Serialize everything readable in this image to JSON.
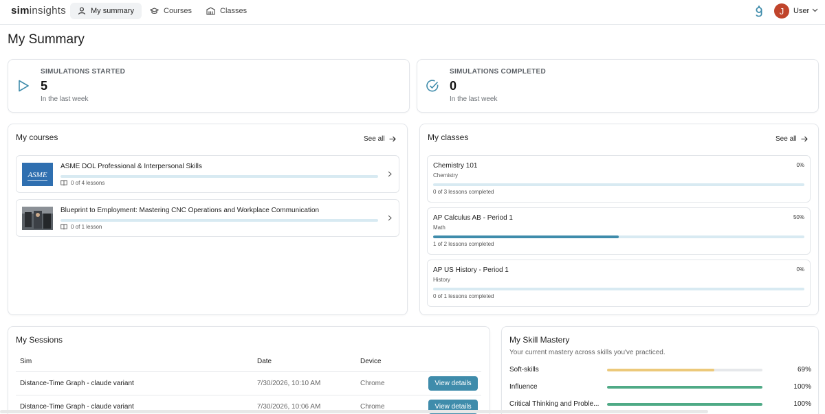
{
  "app": {
    "logo_bold": "sim",
    "logo_light": "insights",
    "nav": [
      {
        "label": "My summary",
        "icon": "user-icon",
        "active": true
      },
      {
        "label": "Courses",
        "icon": "graduation-cap-icon",
        "active": false
      },
      {
        "label": "Classes",
        "icon": "building-icon",
        "active": false
      }
    ],
    "user": {
      "initial": "J",
      "name": "User"
    }
  },
  "page_title": "My Summary",
  "stats": {
    "started": {
      "label": "SIMULATIONS STARTED",
      "value": "5",
      "sub": "In the last week"
    },
    "completed": {
      "label": "SIMULATIONS COMPLETED",
      "value": "0",
      "sub": "In the last week"
    }
  },
  "courses": {
    "title": "My courses",
    "see_all": "See all",
    "items": [
      {
        "title": "ASME DOL Professional & Interpersonal Skills",
        "lessons": "0 of 4 lessons",
        "progress": 0
      },
      {
        "title": "Blueprint to Employment: Mastering CNC Operations and Workplace Communication",
        "lessons": "0 of 1 lesson",
        "progress": 0
      }
    ]
  },
  "classes": {
    "title": "My classes",
    "see_all": "See all",
    "items": [
      {
        "name": "Chemistry 101",
        "subject": "Chemistry",
        "percent": "0%",
        "progress": 0,
        "completed": "0 of 3 lessons completed"
      },
      {
        "name": "AP Calculus AB - Period 1",
        "subject": "Math",
        "percent": "50%",
        "progress": 0.5,
        "completed": "1 of 2 lessons completed"
      },
      {
        "name": "AP US History - Period 1",
        "subject": "History",
        "percent": "0%",
        "progress": 0,
        "completed": "0 of 1 lessons completed"
      }
    ]
  },
  "sessions": {
    "title": "My Sessions",
    "columns": [
      "Sim",
      "Date",
      "Device"
    ],
    "rows": [
      {
        "sim": "Distance-Time Graph - claude variant",
        "date": "7/30/2026, 10:10 AM",
        "device": "Chrome",
        "action": "View details"
      },
      {
        "sim": "Distance-Time Graph - claude variant",
        "date": "7/30/2026, 10:06 AM",
        "device": "Chrome",
        "action": "View details"
      }
    ]
  },
  "skills": {
    "title": "My Skill Mastery",
    "subtitle": "Your current mastery across skills you've practiced.",
    "items": [
      {
        "name": "Soft-skills",
        "percent": "69%",
        "value": 0.69,
        "color": "#ecc97a"
      },
      {
        "name": "Influence",
        "percent": "100%",
        "value": 1.0,
        "color": "#4faa86"
      },
      {
        "name": "Critical Thinking and Problem Solving",
        "display": "Critical Thinking and Proble...",
        "percent": "100%",
        "value": 1.0,
        "color": "#4faa86"
      }
    ]
  },
  "colors": {
    "accent": "#3f8cab",
    "avatar": "#c0442b",
    "track": "#d8eaf2"
  }
}
